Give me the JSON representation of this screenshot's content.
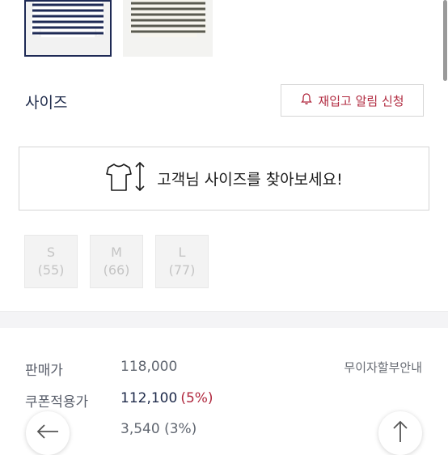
{
  "colors": {
    "navy": "#1e2a55",
    "accent_red": "#b0283e"
  },
  "swatches": [
    {
      "name": "navy-stripe",
      "selected": true
    },
    {
      "name": "beige-stripe",
      "selected": false
    }
  ],
  "size_section": {
    "label": "사이즈",
    "restock_button": "재입고 알림 신청",
    "restock_icon": "bell-icon"
  },
  "find_size": {
    "label": "고객님 사이즈를 찾아보세요!",
    "icons": [
      "tshirt-icon",
      "height-arrow-icon"
    ]
  },
  "size_options": [
    {
      "size": "S",
      "sub": "(55)"
    },
    {
      "size": "M",
      "sub": "(66)"
    },
    {
      "size": "L",
      "sub": "(77)"
    }
  ],
  "pricing": {
    "sale_label": "판매가",
    "sale_price": "118,000",
    "installment": "무이자할부안내",
    "coupon_label": "쿠폰적용가",
    "coupon_price": "112,100",
    "coupon_pct": "(5%)",
    "points": "3,540 (3%)"
  },
  "fab": {
    "back_icon": "arrow-left-icon",
    "top_icon": "arrow-up-icon"
  }
}
